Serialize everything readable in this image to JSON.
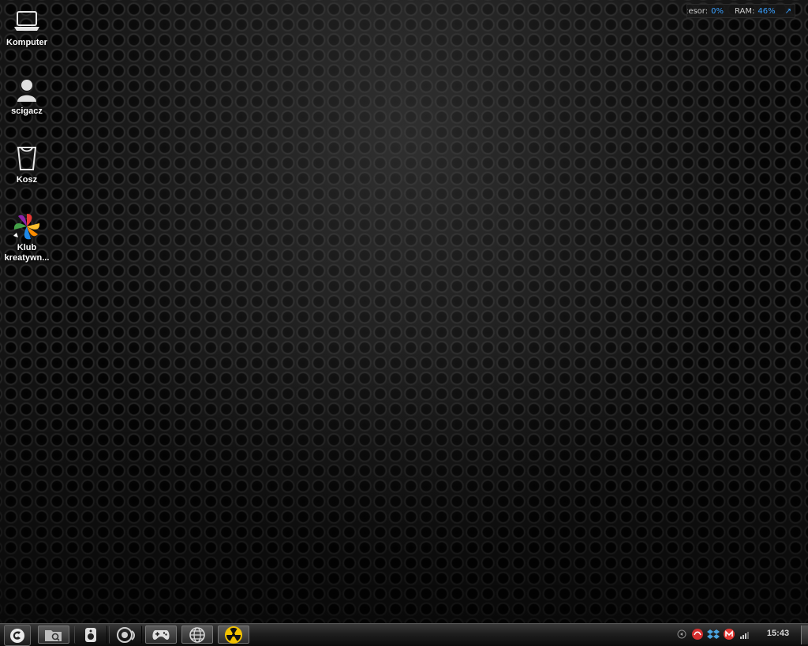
{
  "desktop": {
    "icons": [
      {
        "label": "Komputer",
        "icon": "laptop-icon"
      },
      {
        "label": "scigacz",
        "icon": "user-icon"
      },
      {
        "label": "Kosz",
        "icon": "trash-icon"
      },
      {
        "label": "Klub kreatywn...",
        "icon": "pinwheel-icon"
      }
    ]
  },
  "sysmon": {
    "cpu_label": "ocesor:",
    "cpu_value": "0%",
    "ram_label": "RAM:",
    "ram_value": "46%",
    "arrow": "↗"
  },
  "taskbar": {
    "start_icon": "start-orb-icon",
    "buttons": [
      {
        "icon": "folder-search-icon"
      },
      {
        "icon": "speaker-icon"
      },
      {
        "icon": "webcam-icon"
      },
      {
        "icon": "gamepad-icon"
      },
      {
        "icon": "globe-icon"
      },
      {
        "icon": "radiation-icon"
      }
    ],
    "tray": [
      {
        "icon": "volume-icon"
      },
      {
        "icon": "red-app-icon"
      },
      {
        "icon": "dropbox-icon"
      },
      {
        "icon": "gmail-icon"
      },
      {
        "icon": "signal-icon"
      }
    ],
    "clock": "15:43"
  },
  "colors": {
    "accent": "#3aa0ff",
    "radiation": "#f2c200"
  }
}
